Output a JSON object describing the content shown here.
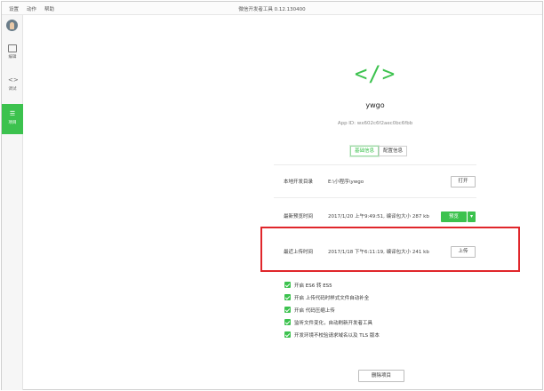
{
  "menu": {
    "items": [
      "设置",
      "动作",
      "帮助"
    ]
  },
  "app_title": "微信开发者工具 0.12.130400",
  "sidebar": {
    "items": [
      {
        "label": "编辑",
        "icon": "edit-icon"
      },
      {
        "label": "调试",
        "icon": "code-icon"
      },
      {
        "label": "项目",
        "icon": "menu-icon"
      }
    ],
    "active": "项目"
  },
  "project": {
    "logo": "</>",
    "name": "ywgo",
    "appid": "App ID: wx602c6f2aec0bc6fbb"
  },
  "tabs": [
    {
      "label": "基础信息"
    },
    {
      "label": "配置信息"
    }
  ],
  "rows": {
    "local_dir": {
      "label": "本地开发目录",
      "value": "E:\\小程序\\ywgo",
      "button": "打开"
    },
    "preview": {
      "label": "最新预览时间",
      "value": "2017/1/20 上午9:49:51, 编译包大小 287 kb",
      "button": "预览",
      "dropdown": "▾"
    },
    "upload": {
      "label": "最近上传时间",
      "value": "2017/1/18 下午6:11:19, 编译包大小 241 kb",
      "button": "上传"
    }
  },
  "options": [
    {
      "label": "开启 ES6 转 ES5",
      "checked": true
    },
    {
      "label": "开启 上传代码时样式文件自动补全",
      "checked": true
    },
    {
      "label": "开启 代码压缩上传",
      "checked": true
    },
    {
      "label": "监听文件变化，自动刷新开发者工具",
      "checked": true
    },
    {
      "label": "开发环境不校验请求域名以及 TLS 版本",
      "checked": true
    }
  ],
  "delete_button": "删除项目",
  "colors": {
    "accent": "#3cc24e",
    "highlight": "#e0262b"
  }
}
